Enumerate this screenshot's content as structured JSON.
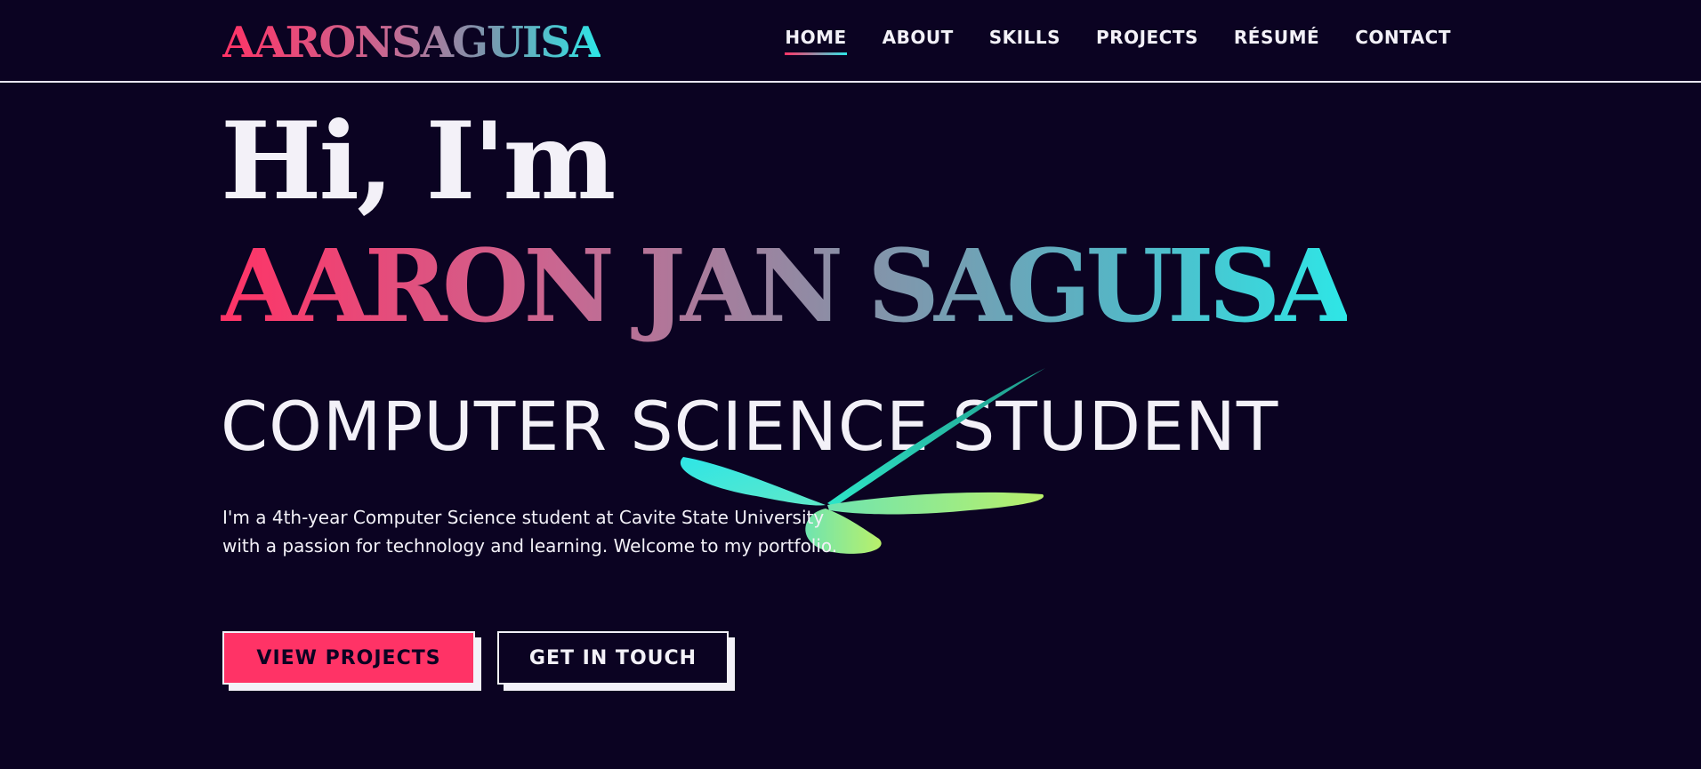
{
  "header": {
    "logo": "AARONSAGUISA",
    "nav": [
      {
        "label": "HOME",
        "active": true
      },
      {
        "label": "ABOUT",
        "active": false
      },
      {
        "label": "SKILLS",
        "active": false
      },
      {
        "label": "PROJECTS",
        "active": false
      },
      {
        "label": "RÉSUMÉ",
        "active": false
      },
      {
        "label": "CONTACT",
        "active": false
      }
    ]
  },
  "hero": {
    "greeting": "Hi, I'm",
    "name": "AARON JAN SAGUISA",
    "role": "COMPUTER SCIENCE STUDENT",
    "description": "I'm a 4th-year Computer Science student at Cavite State University with a passion for technology and learning. Welcome to my portfolio.",
    "primary_button": "VIEW PROJECTS",
    "secondary_button": "GET IN TOUCH"
  },
  "colors": {
    "background": "#0b0322",
    "accent_pink": "#ff3366",
    "accent_cyan": "#2ee6e6",
    "text": "#f3f1f8"
  },
  "icons": {
    "decoration": "dragonfly-icon"
  }
}
